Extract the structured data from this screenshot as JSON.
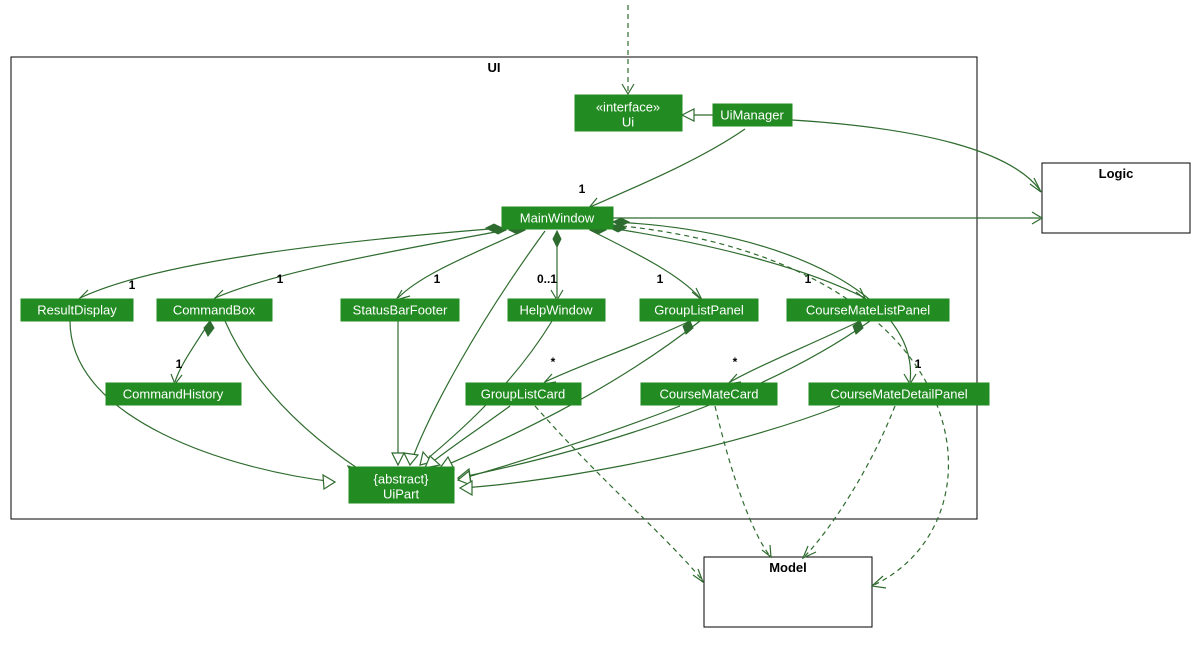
{
  "packages": {
    "ui": "UI",
    "logic": "Logic",
    "model": "Model"
  },
  "classes": {
    "ui_iface": {
      "line1": "«interface»",
      "line2": "Ui"
    },
    "ui_manager": "UiManager",
    "main_window": "MainWindow",
    "result_display": "ResultDisplay",
    "command_box": "CommandBox",
    "status_bar_footer": "StatusBarFooter",
    "help_window": "HelpWindow",
    "group_list_panel": "GroupListPanel",
    "course_mate_list_panel": "CourseMateListPanel",
    "command_history": "CommandHistory",
    "group_list_card": "GroupListCard",
    "course_mate_card": "CourseMateCard",
    "course_mate_detail_panel": "CourseMateDetailPanel",
    "ui_part": {
      "line1": "{abstract}",
      "line2": "UiPart"
    }
  },
  "multiplicities": {
    "mw": "1",
    "rd": "1",
    "cb": "1",
    "sbf": "1",
    "hw": "0..1",
    "glp": "1",
    "cmlp": "1",
    "ch": "1",
    "glc": "*",
    "cmc": "*",
    "cmdp": "1"
  },
  "chart_data": {
    "type": "uml-class-diagram",
    "packages": [
      "UI",
      "Logic",
      "Model"
    ],
    "classes_in_ui": [
      "Ui (interface)",
      "UiManager",
      "MainWindow",
      "ResultDisplay",
      "CommandBox",
      "StatusBarFooter",
      "HelpWindow",
      "GroupListPanel",
      "CourseMateListPanel",
      "CommandHistory",
      "GroupListCard",
      "CourseMateCard",
      "CourseMateDetailPanel",
      "UiPart (abstract)"
    ],
    "relations": [
      {
        "from": "(external)",
        "to": "Ui",
        "kind": "dependency"
      },
      {
        "from": "UiManager",
        "to": "Ui",
        "kind": "realization"
      },
      {
        "from": "UiManager",
        "to": "MainWindow",
        "kind": "association",
        "mult": "1"
      },
      {
        "from": "UiManager",
        "to": "Logic",
        "kind": "association"
      },
      {
        "from": "MainWindow",
        "to": "Logic",
        "kind": "association"
      },
      {
        "from": "MainWindow",
        "to": "ResultDisplay",
        "kind": "composition",
        "mult": "1"
      },
      {
        "from": "MainWindow",
        "to": "CommandBox",
        "kind": "composition",
        "mult": "1"
      },
      {
        "from": "MainWindow",
        "to": "StatusBarFooter",
        "kind": "composition",
        "mult": "1"
      },
      {
        "from": "MainWindow",
        "to": "HelpWindow",
        "kind": "composition",
        "mult": "0..1"
      },
      {
        "from": "MainWindow",
        "to": "GroupListPanel",
        "kind": "composition",
        "mult": "1"
      },
      {
        "from": "MainWindow",
        "to": "CourseMateListPanel",
        "kind": "composition",
        "mult": "1"
      },
      {
        "from": "MainWindow",
        "to": "CourseMateDetailPanel",
        "kind": "composition",
        "mult": "1"
      },
      {
        "from": "CommandBox",
        "to": "CommandHistory",
        "kind": "composition",
        "mult": "1"
      },
      {
        "from": "GroupListPanel",
        "to": "GroupListCard",
        "kind": "composition",
        "mult": "*"
      },
      {
        "from": "CourseMateListPanel",
        "to": "CourseMateCard",
        "kind": "composition",
        "mult": "*"
      },
      {
        "from": "MainWindow",
        "to": "UiPart",
        "kind": "generalization"
      },
      {
        "from": "ResultDisplay",
        "to": "UiPart",
        "kind": "generalization"
      },
      {
        "from": "CommandBox",
        "to": "UiPart",
        "kind": "generalization"
      },
      {
        "from": "StatusBarFooter",
        "to": "UiPart",
        "kind": "generalization"
      },
      {
        "from": "HelpWindow",
        "to": "UiPart",
        "kind": "generalization"
      },
      {
        "from": "GroupListPanel",
        "to": "UiPart",
        "kind": "generalization"
      },
      {
        "from": "CourseMateListPanel",
        "to": "UiPart",
        "kind": "generalization"
      },
      {
        "from": "GroupListCard",
        "to": "UiPart",
        "kind": "generalization"
      },
      {
        "from": "CourseMateCard",
        "to": "UiPart",
        "kind": "generalization"
      },
      {
        "from": "CourseMateDetailPanel",
        "to": "UiPart",
        "kind": "generalization"
      },
      {
        "from": "GroupListCard",
        "to": "Model",
        "kind": "dependency"
      },
      {
        "from": "CourseMateCard",
        "to": "Model",
        "kind": "dependency"
      },
      {
        "from": "CourseMateDetailPanel",
        "to": "Model",
        "kind": "dependency"
      },
      {
        "from": "MainWindow",
        "to": "Model",
        "kind": "dependency"
      }
    ]
  }
}
